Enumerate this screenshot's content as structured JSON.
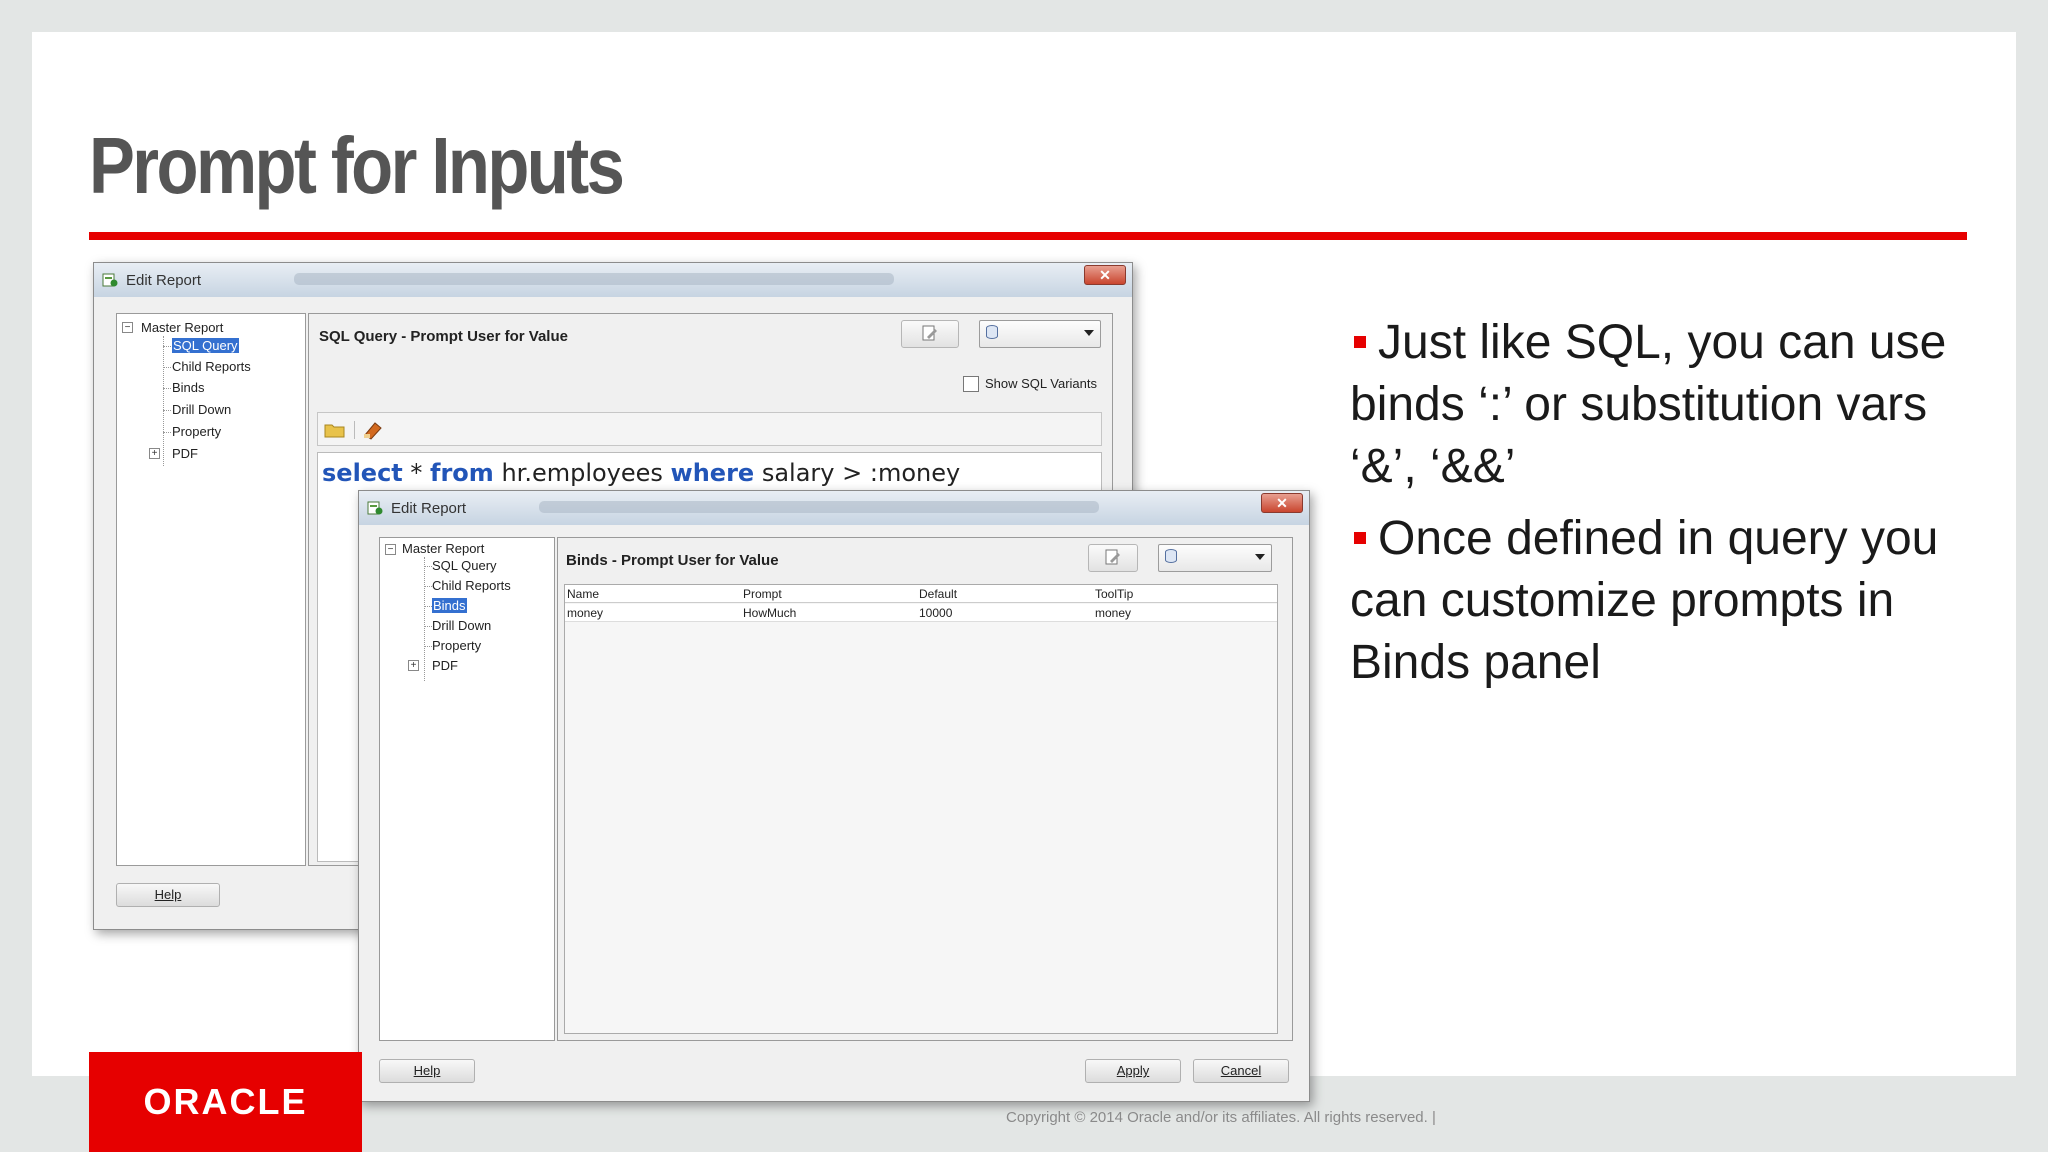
{
  "slide": {
    "title": "Prompt for Inputs",
    "bullets": [
      "Just like SQL, you can use binds ‘:’ or substitution vars ‘&’, ‘&&’",
      "Once defined in query you can customize prompts in Binds panel"
    ],
    "footer": "Copyright © 2014 Oracle and/or its affiliates. All rights reserved.  |",
    "logo_text": "ORACLE",
    "colors": {
      "accent": "#e60000",
      "title": "#555555"
    }
  },
  "back_dialog": {
    "title": "Edit Report",
    "close_glyph": "✕",
    "tree": {
      "root": "Master Report",
      "items": [
        "SQL Query",
        "Child Reports",
        "Binds",
        "Drill Down",
        "Property",
        "PDF"
      ],
      "selected": "SQL Query"
    },
    "panel_title": "SQL Query - Prompt User for Value",
    "show_sql_variants": "Show SQL Variants",
    "sql": {
      "kw_select": "select",
      "star": " * ",
      "kw_from": "from",
      "table": " hr.employees ",
      "kw_where": "where",
      "cond": " salary > :money"
    },
    "help_label": "Help"
  },
  "front_dialog": {
    "title": "Edit Report",
    "close_glyph": "✕",
    "tree": {
      "root": "Master Report",
      "items": [
        "SQL Query",
        "Child Reports",
        "Binds",
        "Drill Down",
        "Property",
        "PDF"
      ],
      "selected": "Binds"
    },
    "panel_title": "Binds - Prompt User for Value",
    "table": {
      "columns": [
        "Name",
        "Prompt",
        "Default",
        "ToolTip"
      ],
      "rows": [
        [
          "money",
          "HowMuch",
          "10000",
          "money"
        ]
      ]
    },
    "help_label": "Help",
    "apply_label": "Apply",
    "cancel_label": "Cancel"
  }
}
